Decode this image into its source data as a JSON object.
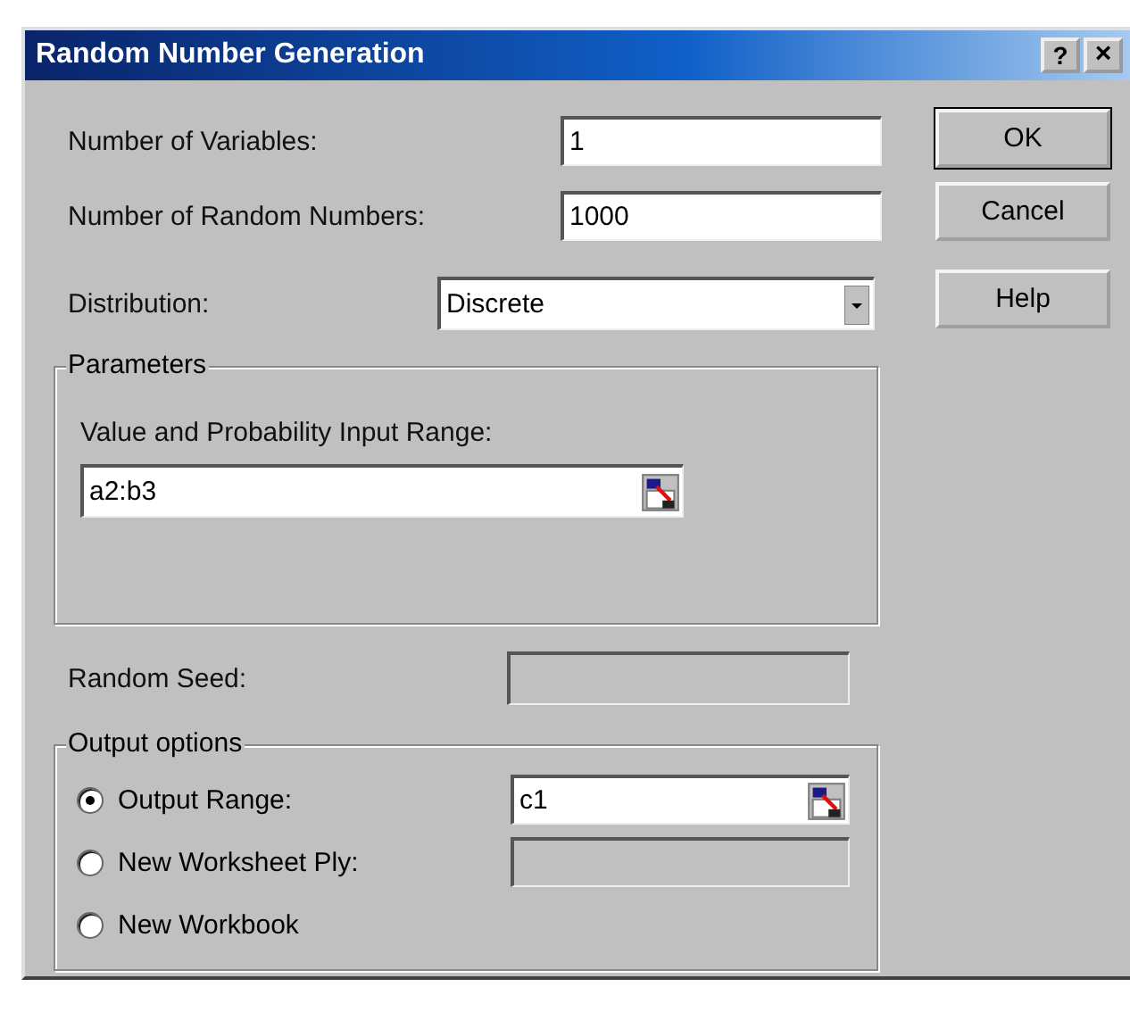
{
  "window": {
    "title": "Random Number Generation",
    "title_buttons": [
      {
        "kind": "help",
        "label": "?"
      },
      {
        "kind": "close",
        "label": "×"
      }
    ]
  },
  "fields": [
    {
      "label": "Number of Variables:",
      "value": "1"
    },
    {
      "label": "Number of Random Numbers:",
      "value": "1000"
    }
  ],
  "distribution": {
    "label": "Distribution:",
    "value": "Discrete"
  },
  "buttons": [
    {
      "label": "OK",
      "default": true
    },
    {
      "label": "Cancel",
      "default": false
    },
    {
      "label": "Help",
      "default": false
    }
  ],
  "parameters": {
    "title": "Parameters",
    "label": "Value and Probability Input Range:",
    "value": "a2:b3"
  },
  "random_seed": {
    "label": "Random Seed:",
    "disabled": true
  },
  "output_options": {
    "title": "Output options",
    "options": [
      {
        "label": "Output Range:",
        "selected": true,
        "field": {
          "value": "c1",
          "ref_button": true,
          "disabled": false
        }
      },
      {
        "label": "New Worksheet Ply:",
        "selected": false,
        "field": {
          "ref_button": false,
          "disabled": true
        }
      },
      {
        "label": "New Workbook",
        "selected": false
      }
    ]
  }
}
